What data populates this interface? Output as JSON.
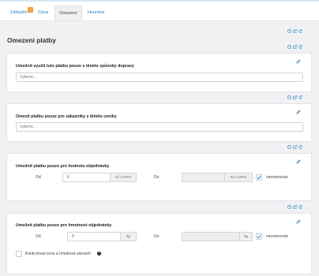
{
  "tabs": [
    {
      "label": "Základní",
      "badge": "!"
    },
    {
      "label": "Cena"
    },
    {
      "label": "Omezení"
    },
    {
      "label": "Heureka"
    }
  ],
  "section_title": "Omezení platby",
  "panels": {
    "shipping": {
      "label": "Umožnit využít tuto platbu pouze s těmito způsoby dopravy",
      "placeholder": "Vyberte..."
    },
    "pricelists": {
      "label": "Omezit platbu pouze pro zákazníky s těmito ceníky",
      "placeholder": "Vyberte..."
    },
    "order_value": {
      "label": "Umožnit platbu pouze pro hodnotu objednávky",
      "from_label": "Od",
      "from_value": "0",
      "from_unit": "Kč s DPH",
      "to_label": "Do",
      "to_value": "",
      "to_unit": "Kč s DPH",
      "unlimited_label": "neomezovat",
      "unlimited_checked": true
    },
    "order_weight": {
      "label": "Umožnit platbu pouze pro hmotnost objednávky",
      "from_label": "Od",
      "from_value": "0",
      "from_unit": "kg",
      "to_label": "Do",
      "to_value": "",
      "to_unit": "kg",
      "unlimited_label": "neomezovat",
      "unlimited_checked": true,
      "combine_label": "Kontrolovat cenu a hmotnost zároveň",
      "combine_checked": false,
      "help": "?"
    }
  },
  "colors": {
    "link": "#2a7fbf",
    "badge": "#f29b38",
    "check": "#2a7fbf"
  },
  "icons": [
    "question-icon",
    "export-icon",
    "refresh-icon",
    "pencil-icon",
    "check-icon"
  ]
}
